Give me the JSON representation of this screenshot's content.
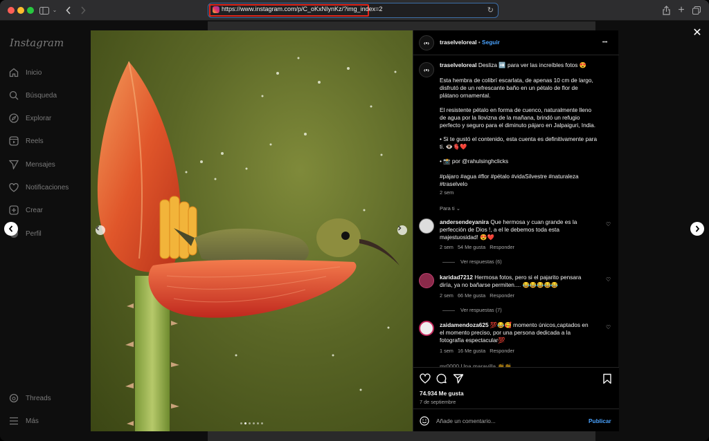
{
  "browser": {
    "url": "https://www.instagram.com/p/C_oKxNIynKz/?img_index=2"
  },
  "sidebar": {
    "logo": "Instagram",
    "items": [
      {
        "label": "Inicio",
        "icon": "home-icon"
      },
      {
        "label": "Búsqueda",
        "icon": "search-icon"
      },
      {
        "label": "Explorar",
        "icon": "compass-icon"
      },
      {
        "label": "Reels",
        "icon": "reels-icon"
      },
      {
        "label": "Mensajes",
        "icon": "send-icon"
      },
      {
        "label": "Notificaciones",
        "icon": "heart-icon"
      },
      {
        "label": "Crear",
        "icon": "plus-square-icon"
      },
      {
        "label": "Perfil",
        "icon": "profile-icon"
      }
    ],
    "bottom_items": [
      {
        "label": "Threads",
        "icon": "threads-icon"
      },
      {
        "label": "Más",
        "icon": "menu-icon"
      }
    ]
  },
  "post": {
    "username": "traselveloreal",
    "separator": "•",
    "follow_label": "Seguir",
    "more_label": "•••",
    "carousel": {
      "count": 6,
      "active_index": 2
    },
    "caption": {
      "username": "traselveloreal",
      "line1": "Desliza ➡️ para ver las increíbles fotos 😍",
      "p1": [
        "Esta hembra de colibrí escarlata, de apenas 10 cm de largo,",
        "disfrutó de un refrescante baño en un pétalo de flor de",
        "plátano ornamental."
      ],
      "p2": [
        "El resistente pétalo en forma de cuenco, naturalmente lleno",
        "de agua por la llovizna de la mañana, brindó un refugio",
        "perfecto y seguro para el diminuto pájaro en Jalpaiguri, India."
      ],
      "p3": [
        "• Si te gustó el contenido, esta cuenta es definitivamente para",
        "ti. 👁️🫀❤️"
      ],
      "p4": "• 📸 por @rahulsinghclicks",
      "tags": [
        "#pájaro #agua #flor #pétalo #vidaSilvestre #naturaleza",
        "#traselvelo"
      ],
      "age": "2 sem"
    },
    "for_you": "Para ti",
    "comments": [
      {
        "user": "andersendeyanira",
        "lines": [
          "Que hermosa y cuan grande es la",
          "perfección de Dios !, a el le debemos toda esta",
          "majestuosidad! 😍❤️"
        ],
        "age": "2 sem",
        "likes": "54 Me gusta",
        "reply": "Responder",
        "replies": "Ver respuestas (6)"
      },
      {
        "user": "karidad7212",
        "lines": [
          "Hermosa fotos, pero si el pajarito pensara",
          "diría, ya no bañarse permiten.... 😂😂😂😂😂"
        ],
        "age": "2 sem",
        "likes": "66 Me gusta",
        "reply": "Responder",
        "replies": "Ver respuestas (7)"
      },
      {
        "user": "zaidamendoza625",
        "lines": [
          "💯😂🥰 momento únicos,captados en",
          "el momento preciso, por una persona dedicada a la",
          "fotografía espectacular💯"
        ],
        "age": "1 sem",
        "likes": "16 Me gusta",
        "reply": "Responder"
      }
    ],
    "partial_comment": "mr0000 Una maravilla 👏👏",
    "likes_total": "74.934 Me gusta",
    "date": "7 de septiembre",
    "add_comment_placeholder": "Añade un comentario...",
    "publish_label": "Publicar"
  }
}
